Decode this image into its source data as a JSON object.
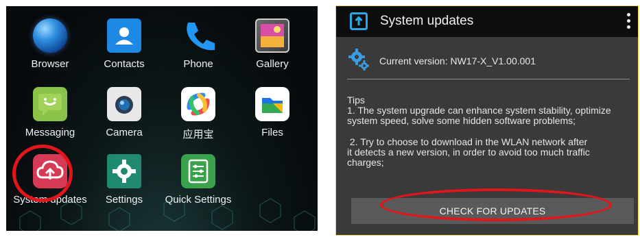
{
  "launcher": {
    "apps": [
      {
        "label": "Browser",
        "icon": "globe-icon"
      },
      {
        "label": "Contacts",
        "icon": "contacts-icon"
      },
      {
        "label": "Phone",
        "icon": "phone-icon"
      },
      {
        "label": "Gallery",
        "icon": "gallery-icon"
      },
      {
        "label": "Messaging",
        "icon": "messaging-icon"
      },
      {
        "label": "Camera",
        "icon": "camera-icon"
      },
      {
        "label": "应用宝",
        "icon": "app-store-icon"
      },
      {
        "label": "Files",
        "icon": "files-icon"
      },
      {
        "label": "System updates",
        "icon": "system-update-icon"
      },
      {
        "label": "Settings",
        "icon": "gear-icon"
      },
      {
        "label": "Quick Settings",
        "icon": "quick-settings-icon"
      }
    ]
  },
  "system_updates": {
    "title": "System updates",
    "current_version": "Current version: NW17-X_V1.00.001",
    "tips_heading": "Tips",
    "tips_1_line1": "1. The system upgrade can enhance system stability, optimize",
    "tips_1_line2": "system speed, solve some hidden software problems;",
    "tips_2_line1": " 2. Try to choose to download in the WLAN network after",
    "tips_2_line2": "it detects a new version, in order to avoid too much traffic",
    "tips_2_line3": "charges;",
    "check_button": "CHECK FOR UPDATES"
  },
  "colors": {
    "highlight_ring": "#e0161c",
    "panel_border": "#f2d34a",
    "panel_bg": "#3a3a3a",
    "appbar_bg": "#0d0d0d"
  }
}
